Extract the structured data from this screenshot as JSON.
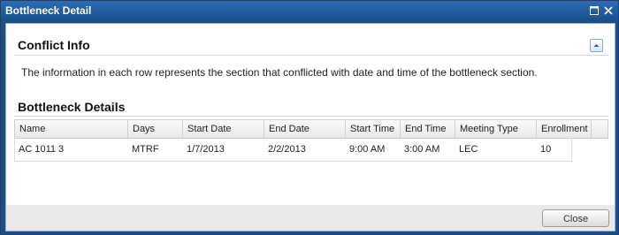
{
  "window": {
    "title": "Bottleneck Detail",
    "controls": {
      "maximize_icon": "maximize-icon",
      "close_icon": "close-icon"
    }
  },
  "conflict_info": {
    "title": "Conflict Info",
    "collapse_icon": "chevron-up-icon",
    "description": "The information in each row represents the section that conflicted with date and time of the bottleneck section."
  },
  "bottleneck_details": {
    "title": "Bottleneck Details",
    "columns": [
      "Name",
      "Days",
      "Start Date",
      "End Date",
      "Start Time",
      "End Time",
      "Meeting Type",
      "Enrollment"
    ],
    "rows": [
      [
        "AC 1011 3",
        "MTRF",
        "1/7/2013",
        "2/2/2013",
        "9:00 AM",
        "3:00 AM",
        "LEC",
        "10"
      ]
    ]
  },
  "footer": {
    "close_label": "Close"
  },
  "colors": {
    "titlebar": "#1b4f8a",
    "footer": "#e9e9e9",
    "border": "#9fb1c9"
  }
}
